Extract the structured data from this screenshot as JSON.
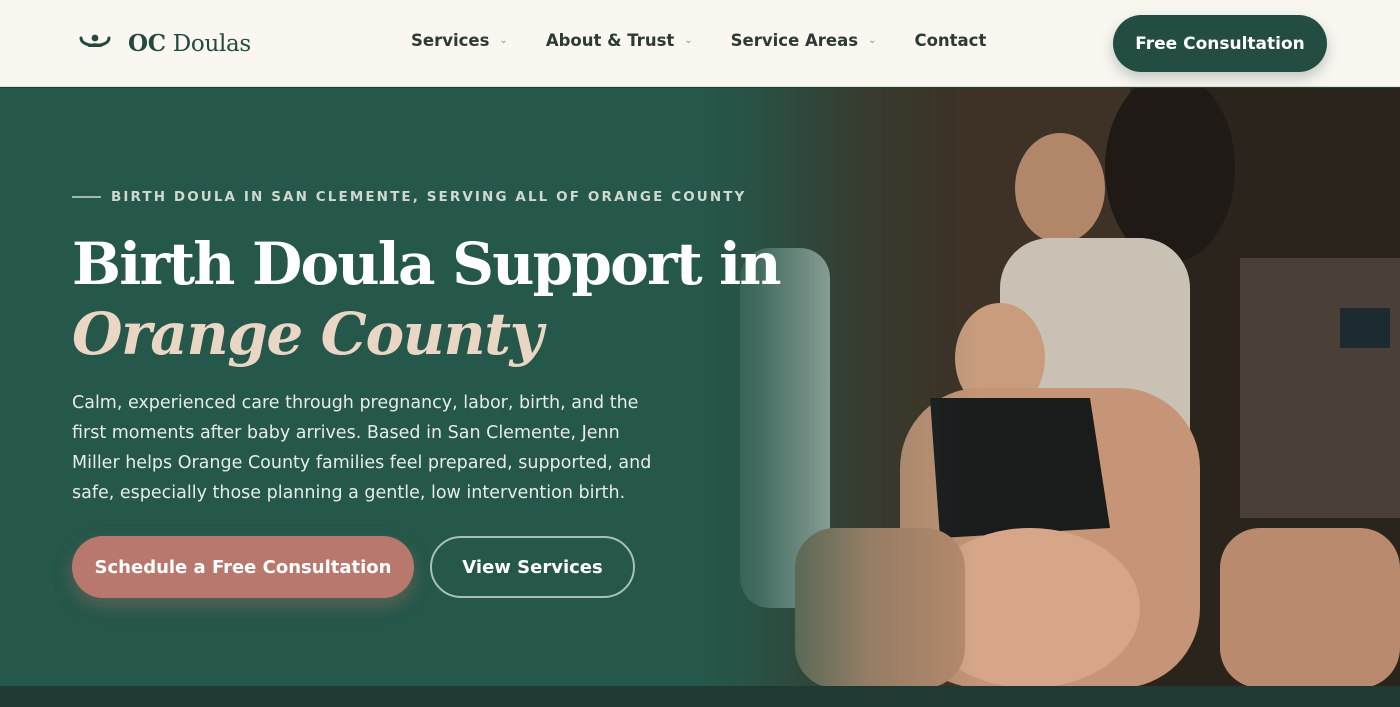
{
  "header": {
    "logo": {
      "brand_bold": "OC",
      "brand_rest": "Doulas",
      "icon": "doula-logo-icon"
    },
    "nav": [
      {
        "label": "Services",
        "has_dropdown": true
      },
      {
        "label": "About & Trust",
        "has_dropdown": true
      },
      {
        "label": "Service Areas",
        "has_dropdown": true
      },
      {
        "label": "Contact",
        "has_dropdown": false
      }
    ],
    "cta_label": "Free Consultation"
  },
  "hero": {
    "eyebrow": "BIRTH DOULA IN SAN CLEMENTE, SERVING ALL OF ORANGE COUNTY",
    "title_line1": "Birth Doula Support in",
    "title_line2": "Orange County",
    "lede": "Calm, experienced care through pregnancy, labor, birth, and the first moments after baby arrives. Based in San Clemente, Jenn Miller helps Orange County families feel prepared, supported, and safe, especially those planning a gentle, low intervention birth.",
    "primary_button": "Schedule a Free Consultation",
    "secondary_button": "View Services"
  },
  "colors": {
    "header_bg": "#faf7f1",
    "brand_green": "#234d42",
    "hero_green": "#25574a",
    "accent_rose": "#b9786d",
    "title_italic": "#ead6c4"
  }
}
